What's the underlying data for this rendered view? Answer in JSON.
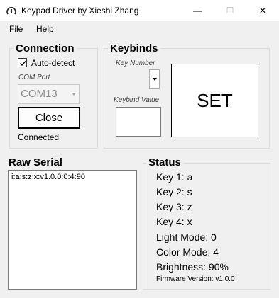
{
  "window": {
    "title": "Keypad Driver by Xieshi Zhang",
    "minimize": "—",
    "maximize": "☐",
    "close": "✕"
  },
  "menu": {
    "items": [
      "File",
      "Help"
    ]
  },
  "connection": {
    "title": "Connection",
    "auto_detect_label": "Auto-detect",
    "auto_detect_checked": true,
    "com_port_label": "COM Port",
    "com_port_value": "COM13",
    "close_button": "Close",
    "status_text": "Connected"
  },
  "keybinds": {
    "title": "Keybinds",
    "key_number_label": "Key Number",
    "key_number_value": "",
    "keybind_value_label": "Keybind Value",
    "keybind_value": "",
    "set_button": "SET"
  },
  "raw_serial": {
    "title": "Raw Serial",
    "text": "i:a:s:z:x:v1.0.0:0:4:90"
  },
  "status": {
    "title": "Status",
    "lines": [
      "Key 1: a",
      "Key 2: s",
      "Key 3: z",
      "Key 4: x",
      "Light Mode: 0",
      "Color Mode: 4",
      "Brightness: 90%"
    ],
    "firmware": "Firmware Version: v1.0.0"
  }
}
